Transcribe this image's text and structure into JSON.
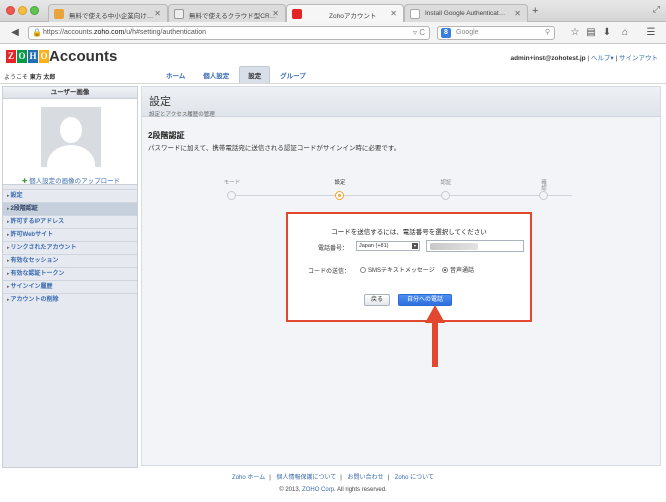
{
  "browser": {
    "tabs": [
      {
        "label": "無料で使える中小企業向け…",
        "active": false
      },
      {
        "label": "無料で使えるクラウド型CR…",
        "active": false
      },
      {
        "label": "Zohoアカウント",
        "active": true
      },
      {
        "label": "Install Google Authenticat…",
        "active": false
      }
    ],
    "url_prefix": "https://accounts.",
    "url_host": "zoho.com",
    "url_path": "/u/h#setting/authentication",
    "search_placeholder": "Google"
  },
  "header": {
    "logo_letters": [
      "Z",
      "O",
      "H",
      "O"
    ],
    "logo_colors": [
      "#e42527",
      "#089949",
      "#226db4",
      "#f9b21d"
    ],
    "title": "Accounts",
    "welcome_prefix": "ようこそ",
    "welcome_name": "東方 太郎",
    "nav": [
      "ホーム",
      "個人設定",
      "設定",
      "グループ"
    ],
    "active_nav": 2,
    "email": "admin+inst@zohotest.jp",
    "help": "ヘルプ▾",
    "signout": "サインアウト"
  },
  "sidebar": {
    "title": "ユーザー画像",
    "upload_label": "個人設定の画像のアップロード",
    "items": [
      {
        "label": "設定",
        "active": false
      },
      {
        "label": "2段階認証",
        "active": true
      },
      {
        "label": "許可するIPアドレス",
        "active": false
      },
      {
        "label": "許可Webサイト",
        "active": false
      },
      {
        "label": "リンクされたアカウント",
        "active": false
      },
      {
        "label": "有効なセッション",
        "active": false
      },
      {
        "label": "有効な認証トークン",
        "active": false
      },
      {
        "label": "サインイン履歴",
        "active": false
      },
      {
        "label": "アカウントの削除",
        "active": false
      }
    ]
  },
  "main": {
    "title": "設定",
    "subtitle": "設定とアクセス履歴の管理",
    "section_title": "2段階認証",
    "section_desc": "パスワードに加えて、携帯電話宛に送信される認証コードがサインイン時に必要です。",
    "steps": [
      "モード",
      "設定",
      "認証",
      "確\n認"
    ],
    "active_step": 1,
    "dialog": {
      "title": "コードを送信するには、電話番号を選択してください",
      "phone_label": "電話番号：",
      "country_value": "Japan (+81)",
      "send_label": "コードの送信：",
      "option_sms": "SMSテキストメッセージ",
      "option_voice": "音声通話",
      "selected_option": "voice",
      "back_button": "戻る",
      "call_button": "自分への電話"
    }
  },
  "footer": {
    "links": [
      "Zoho ホーム",
      "個人情報保護について",
      "お問い合わせ",
      "Zoho について"
    ],
    "copyright_prefix": "© 2013,",
    "copyright_corp": "ZOHO Corp.",
    "copyright_suffix": "All rights reserved."
  },
  "colors": {
    "highlight_border": "#e2472f",
    "arrow": "#e2472f",
    "primary_button": "#2c6fde",
    "link": "#3a6ab0"
  }
}
